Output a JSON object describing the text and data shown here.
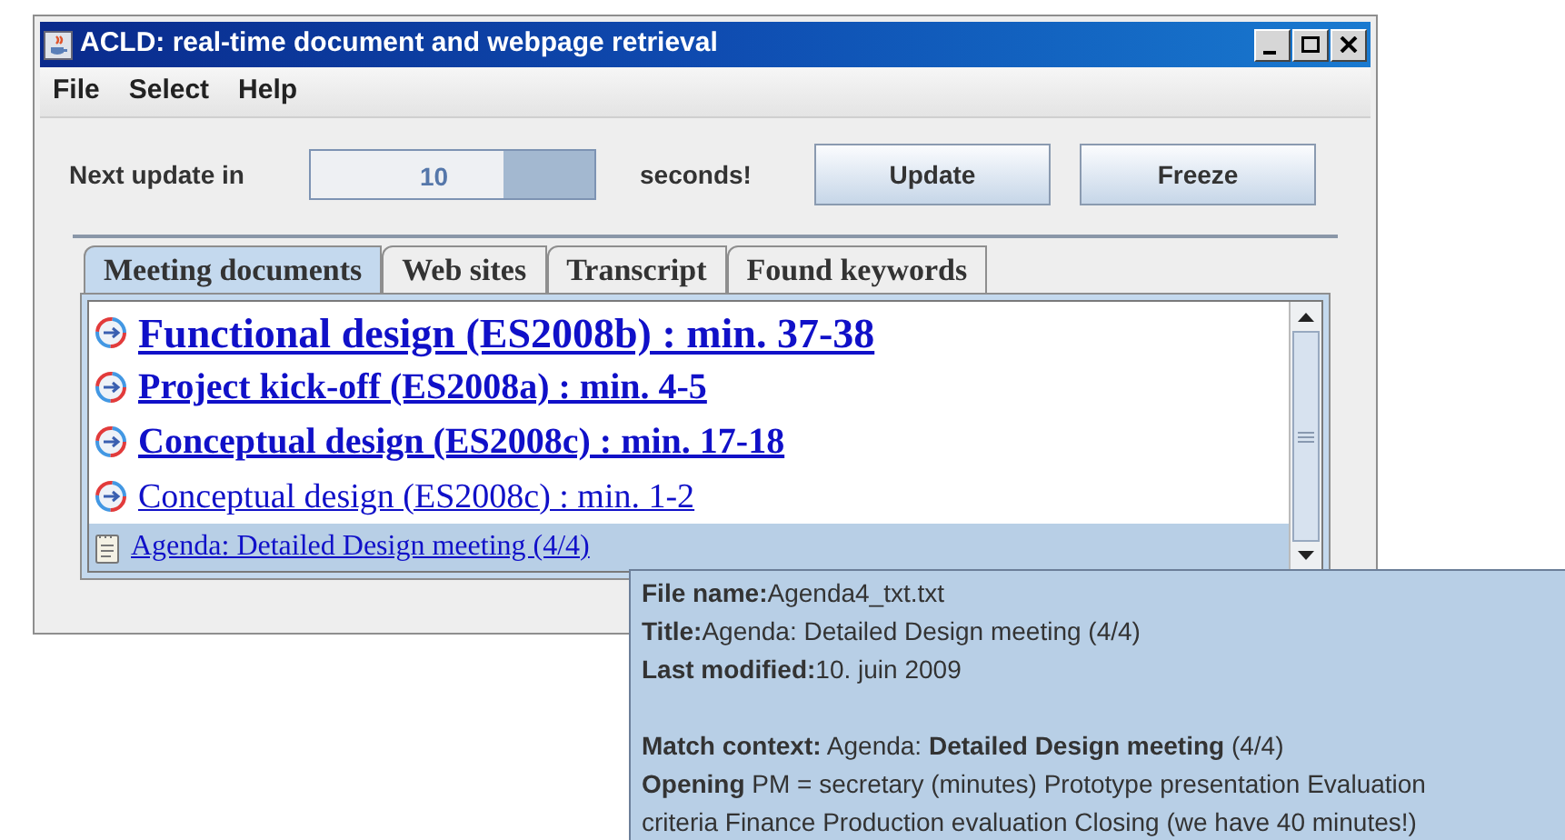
{
  "window": {
    "title": "ACLD: real-time document and webpage retrieval"
  },
  "menu": [
    "File",
    "Select",
    "Help"
  ],
  "update": {
    "label": "Next update in",
    "reading": "10",
    "level": 0.32,
    "suffix": "seconds!"
  },
  "buttons": [
    "Update",
    "Freeze"
  ],
  "tabs": [
    {
      "label": "Meeting documents",
      "selected": true
    },
    {
      "label": "Web sites",
      "selected": false
    },
    {
      "label": "Transcript",
      "selected": false
    },
    {
      "label": "Found keywords",
      "selected": false
    }
  ],
  "results": [
    {
      "kind": "top",
      "title": "Functional design (ES2008b) : min. 37-38",
      "selected": false
    },
    {
      "kind": "strong",
      "title": "Project kick-off (ES2008a) : min. 4-5",
      "selected": false
    },
    {
      "kind": "strong",
      "title": "Conceptual design (ES2008c) : min. 17-18",
      "selected": false
    },
    {
      "kind": "weak",
      "title": "Conceptual design (ES2008c) : min. 1-2",
      "selected": false
    },
    {
      "kind": "document",
      "title": "Agenda: Detailed Design meeting (4/4)",
      "selected": true
    }
  ],
  "tooltip": {
    "sections": [
      [
        "**File name:**Agenda4_txt.txt",
        "**Title:**Agenda: Detailed Design meeting (4/4)",
        "**Last modified:**10. juin 2009"
      ],
      [
        "**Match context:** Agenda: **Detailed Design meeting** (4/4)",
        "**Opening** PM = secretary (minutes) Prototype presentation Evaluation criteria Finance Production evaluation Closing (we have 40 minutes!)"
      ]
    ]
  }
}
